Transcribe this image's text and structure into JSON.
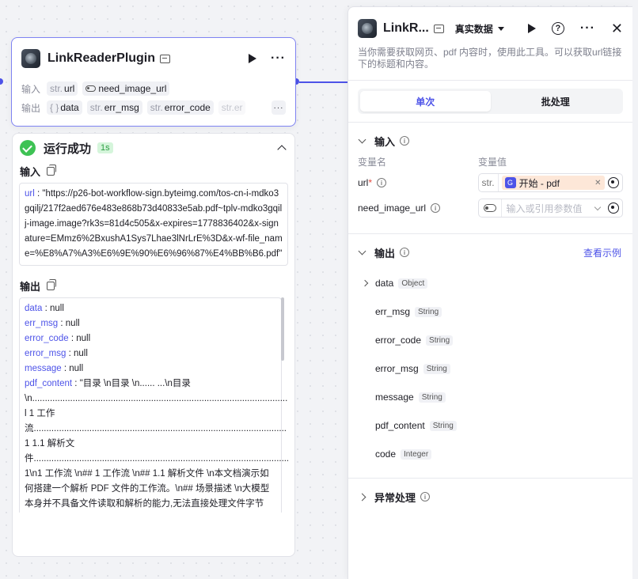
{
  "node": {
    "title": "LinkReaderPlugin",
    "input_label": "输入",
    "output_label": "输出",
    "inputs": [
      {
        "type": "str.",
        "name": "url"
      },
      {
        "type": "",
        "name": "need_image_url"
      }
    ],
    "outputs": [
      {
        "type": "{ }",
        "name": "data"
      },
      {
        "type": "str.",
        "name": "err_msg"
      },
      {
        "type": "str.",
        "name": "error_code"
      },
      {
        "type": "str.",
        "name": "er"
      }
    ]
  },
  "result": {
    "title": "运行成功",
    "duration": "1s",
    "input_title": "输入",
    "output_title": "输出",
    "input_key": "url",
    "input_value": "\"https://p26-bot-workflow-sign.byteimg.com/tos-cn-i-mdko3gqilj/217f2aed676e483e868b73d40833e5ab.pdf~tplv-mdko3gqilj-image.image?rk3s=81d4c505&x-expires=1778836402&x-signature=EMmz6%2BxushA1Sys7Lhae3lNrLrE%3D&x-wf-file_name=%E8%A7%A3%E6%9E%90%E6%96%87%E4%BB%B6.pdf\"",
    "outputs": [
      {
        "key": "data",
        "value": "null"
      },
      {
        "key": "err_msg",
        "value": "null"
      },
      {
        "key": "error_code",
        "value": "null"
      },
      {
        "key": "error_msg",
        "value": "null"
      },
      {
        "key": "message",
        "value": "null"
      }
    ],
    "pdf_key": "pdf_content",
    "pdf_value": "\"目录 \\n目录 \\n...... ...\\n目录 \\n............................................................................................................................................ l 1 工作流.................................................................................................... 1 1.1 解析文件........................................................................................................ 1\\n1 工作流 \\n## 1 工作流 \\n## 1.1 解析文件 \\n本文档演示如何搭建一个解析 PDF 文件的工作流。\\n## 场景描述 \\n大模型本身并不具备文件读取和解析的能力,无法直接处理文件字节流。对于支持 工具调用(Function calling)的模型,把子提供插件功能来帮助大模型调用外部工具 API 拓展"
  },
  "panel": {
    "title": "LinkR...",
    "data_mode": "真实数据",
    "description": "当你需要获取网页、pdf 内容时，使用此工具。可以获取url链接下的标题和内容。",
    "tab_single": "单次",
    "tab_batch": "批处理",
    "input_section": "输入",
    "col_name": "变量名",
    "col_value": "变量值",
    "url_label": "url",
    "url_required": "*",
    "url_prefix": "str.",
    "url_ref": "开始 - pdf",
    "need_image_label": "need_image_url",
    "need_image_placeholder": "输入或引用参数值",
    "output_section": "输出",
    "view_example": "查看示例",
    "outputs": [
      {
        "name": "data",
        "type": "Object"
      },
      {
        "name": "err_msg",
        "type": "String"
      },
      {
        "name": "error_code",
        "type": "String"
      },
      {
        "name": "error_msg",
        "type": "String"
      },
      {
        "name": "message",
        "type": "String"
      },
      {
        "name": "pdf_content",
        "type": "String"
      },
      {
        "name": "code",
        "type": "Integer"
      }
    ],
    "exception_section": "异常处理"
  },
  "colors": {
    "accent": "#4d53e8",
    "success": "#3ec254",
    "required": "#e5483d"
  }
}
